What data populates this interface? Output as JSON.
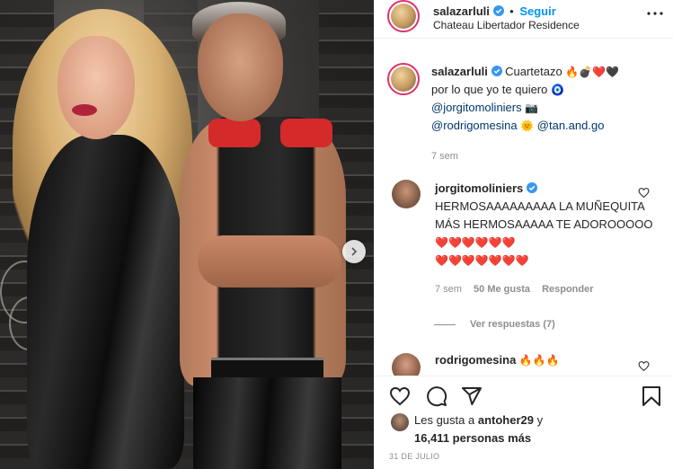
{
  "post": {
    "author": "salazarluli",
    "follow_label": "Seguir",
    "location": "Chateau Libertador Residence",
    "separator": "•"
  },
  "caption": {
    "author": "salazarluli",
    "text_1": "Cuartetazo",
    "emoji_1": "🔥💣❤️🖤",
    "text_2": "por lo que yo te quiero",
    "emoji_2": "🧿",
    "mention_1": "@jorgitomoliniers",
    "emoji_3": "📷",
    "mention_2": "@rodrigomesina",
    "emoji_4": "🌞",
    "mention_3": "@tan.and.go",
    "time": "7 sem"
  },
  "comments": [
    {
      "author": "jorgitomoliniers",
      "text": "HERMOSAAAAAAAAA LA MUÑEQUITA MÁS HERMOSAAAAA TE ADOROOOOO",
      "hearts_line_1": "❤️❤️❤️❤️❤️❤️",
      "hearts_line_2": "❤️❤️❤️❤️❤️❤️❤️",
      "time": "7 sem",
      "likes": "50 Me gusta",
      "reply_label": "Responder",
      "view_replies": "Ver respuestas (7)"
    },
    {
      "author": "rodrigomesina",
      "text": "🔥🔥🔥"
    }
  ],
  "likes": {
    "prefix": "Les gusta a",
    "user": "antoher29",
    "joiner": "y",
    "count": "16,411 personas más"
  },
  "date": "31 DE JULIO",
  "colors": {
    "accent": "#0095f6",
    "verified": "#3897f0",
    "text": "#262626",
    "muted": "#8e8e8e",
    "like_red": "#ed4956"
  },
  "icons": [
    "more-options-icon",
    "heart-icon",
    "comment-icon",
    "share-icon",
    "bookmark-icon",
    "verified-icon",
    "next-arrow-icon"
  ]
}
